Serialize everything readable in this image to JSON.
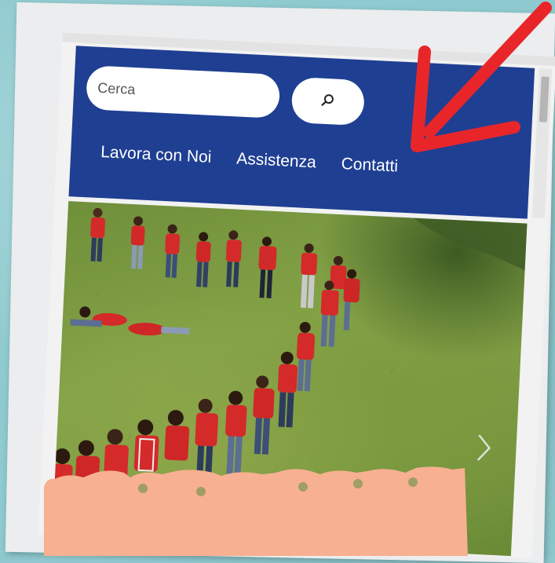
{
  "search": {
    "placeholder": "Cerca"
  },
  "nav": {
    "items": [
      {
        "label": "Lavora con Noi"
      },
      {
        "label": "Assistenza"
      },
      {
        "label": "Contatti"
      }
    ]
  },
  "icons": {
    "search": "search-icon",
    "carousel_next": "chevron-right-icon",
    "annotation": "red-arrow-icon"
  },
  "colors": {
    "header_bg": "#1f3f92",
    "background": "#8ecacf",
    "arrow": "#e8262a",
    "paper": "#f7b091"
  }
}
